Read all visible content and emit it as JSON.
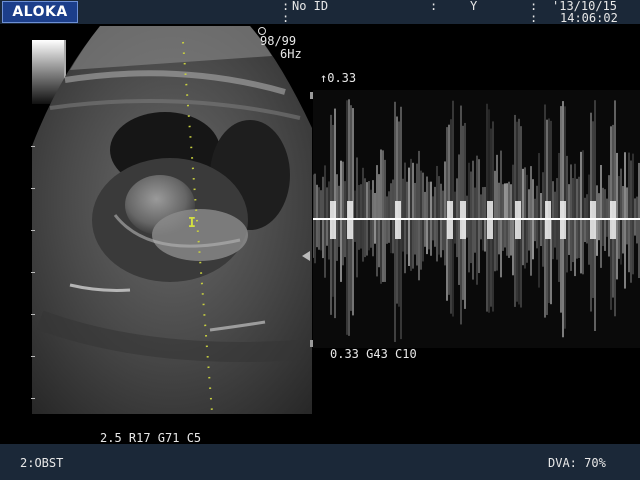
{
  "header": {
    "brand": "ALOKA",
    "patient_id_label": "No ID",
    "field_y": "Y",
    "date": "'13/10/15",
    "time": "14:06:02"
  },
  "b_mode": {
    "frame_info": "98/99",
    "frame_rate": "6Hz",
    "settings": "2.5 R17 G71 C5"
  },
  "doppler": {
    "scale_top": "↑0.33",
    "settings": "0.33 G43 C10"
  },
  "footer": {
    "preset": "2:OBST",
    "dva": "DVA: 70%"
  },
  "colors": {
    "bar_background": "#1b2838",
    "logo_background": "#1c3e8a",
    "gate_marker": "#d4e040"
  },
  "icons": {
    "probe_orientation": "circle-icon",
    "gate": "sample-gate-icon",
    "focus": "focus-triangle-icon"
  }
}
